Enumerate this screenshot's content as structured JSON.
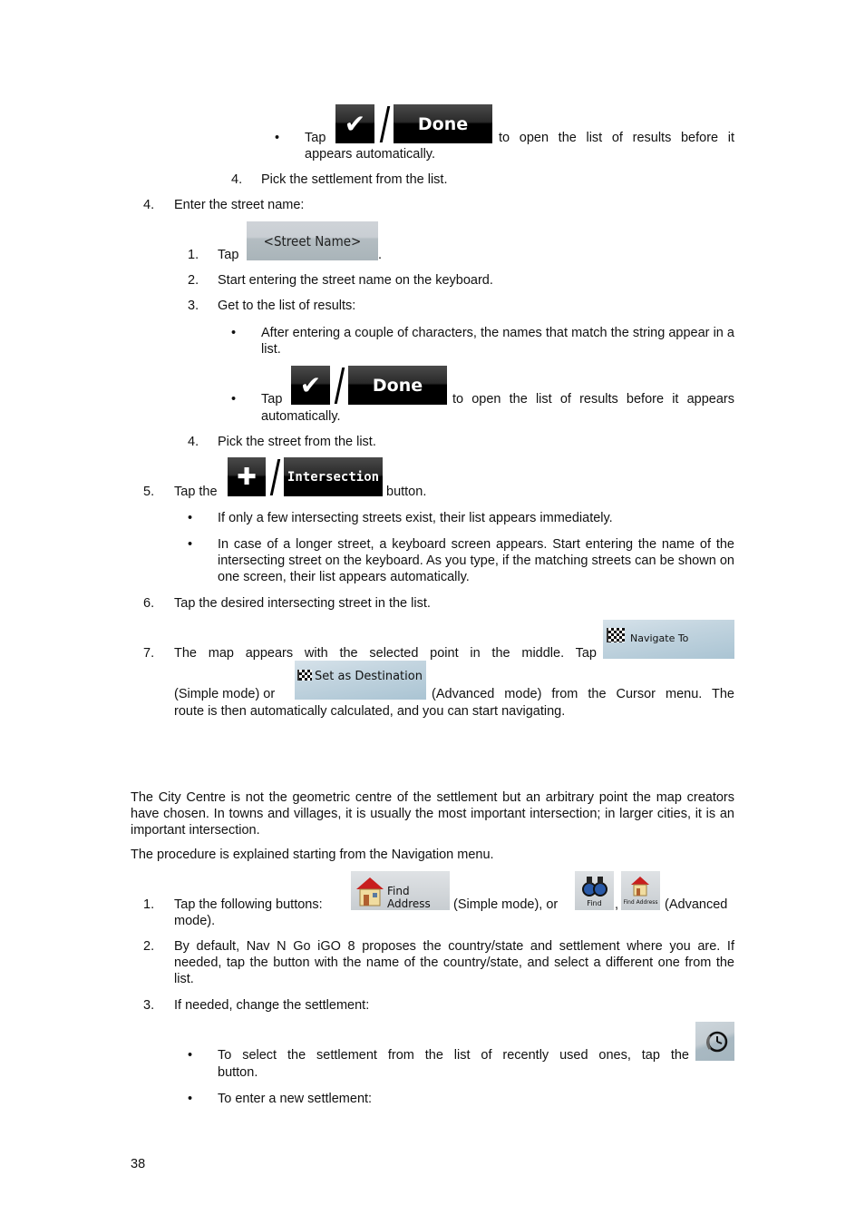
{
  "page_number": "38",
  "buttons": {
    "done": "Done",
    "street_name": "<Street Name>",
    "intersection": "Intersection",
    "navigate_to": "Navigate To",
    "set_as_destination": "Set as Destination",
    "find_address": "Find Address",
    "find": "Find",
    "find_address_small": "Find Address"
  },
  "block1": {
    "bullet_tap": "Tap",
    "bullet_rest_line1": "to open the list of results before it",
    "bullet_rest_line2": "appears automatically.",
    "step4_num": "4.",
    "step4_text": "Pick the settlement from the list."
  },
  "block2": {
    "num": "4.",
    "title": "Enter the street name:",
    "s1_num": "1.",
    "s1_tap": "Tap",
    "s1_after": ".",
    "s2_num": "2.",
    "s2_text": "Start entering the street name on the keyboard.",
    "s3_num": "3.",
    "s3_text": "Get to the list of results:",
    "b1_text": "After entering a couple of characters, the names that match the string appear in a list.",
    "b2_tap": "Tap",
    "b2_rest_line1": "to open the list of results before it appears",
    "b2_rest_line2": "automatically.",
    "s4_num": "4.",
    "s4_text": "Pick the street from the list."
  },
  "block3": {
    "num": "5.",
    "tap_the": "Tap the",
    "button_word": "button.",
    "b1_text": "If only a few intersecting streets exist, their list appears immediately.",
    "b2_text": "In case of a longer street, a keyboard screen appears. Start entering the name of the intersecting street on the keyboard. As you type, if the matching streets can be shown on one screen, their list appears automatically."
  },
  "block4": {
    "num": "6.",
    "text": "Tap the desired intersecting street in the list."
  },
  "block5": {
    "num": "7.",
    "line1": "The map appears with the selected point in the middle. Tap",
    "simple_mode_or": "(Simple mode) or",
    "advanced_rest": "(Advanced mode) from the Cursor menu. The",
    "line3": "route is then automatically calculated, and you can start navigating."
  },
  "section": {
    "para1": "The City Centre is not the geometric centre of the settlement but an arbitrary point the map creators have chosen. In towns and villages, it is usually the most important intersection; in larger cities, it is an important intersection.",
    "para2": "The procedure is explained starting from the Navigation menu.",
    "s1_num": "1.",
    "s1_text": "Tap the following buttons:",
    "s1_simple": "(Simple mode), or",
    "s1_comma": ",",
    "s1_advanced": "(Advanced",
    "s1_line2": "mode).",
    "s2_num": "2.",
    "s2_text": "By default, Nav N Go iGO 8 proposes the country/state and settlement where you are. If needed, tap the button with the name of the country/state, and select a different one from the list.",
    "s3_num": "3.",
    "s3_text": "If needed, change the settlement:",
    "b1_text_line1": "To select the settlement from the list of recently used ones, tap the",
    "b1_text_line2": "button.",
    "b2_text": "To enter a new settlement:"
  }
}
